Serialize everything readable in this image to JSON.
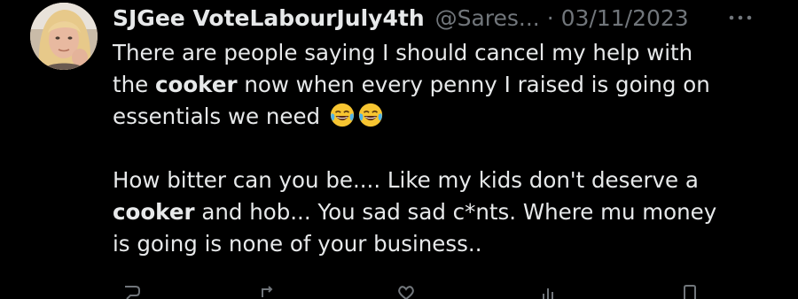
{
  "tweet": {
    "author_name": "SJGee VoteLabourJuly4th",
    "handle": "@Sares...",
    "separator": "·",
    "date": "03/11/2023",
    "more_icon": "more-horizontal-icon",
    "body": {
      "l1_text": "There are people saying I should cancel my help with",
      "l2_prefix": "the ",
      "l2_keyword": "cooker",
      "l2_suffix": " now when every penny I raised is going on",
      "l3_text": "essentials we need ",
      "l4_text": "How bitter can you be.... Like my kids don't deserve a",
      "l5_keyword": "cooker",
      "l5_suffix": " and hob... You sad sad c*nts. Where mu money",
      "l6_text": "is going is none of your business.."
    },
    "emoji": [
      "face-with-tears-of-joy",
      "face-with-tears-of-joy"
    ],
    "actions": [
      "reply-icon",
      "retweet-icon",
      "like-icon",
      "views-icon",
      "bookmark-icon"
    ]
  },
  "colors": {
    "background": "#000000",
    "text": "#e7e9ea",
    "secondary": "#71767b"
  }
}
